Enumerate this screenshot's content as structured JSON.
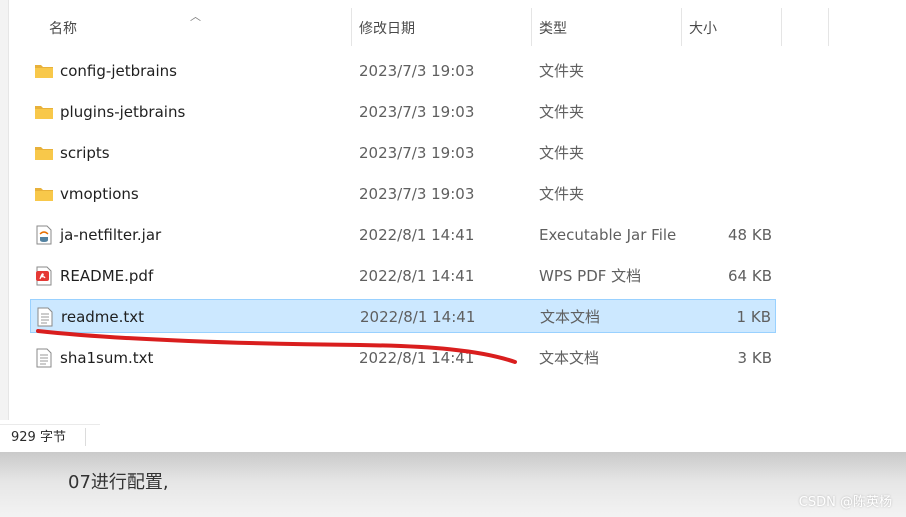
{
  "columns": {
    "name": "名称",
    "date": "修改日期",
    "type": "类型",
    "size": "大小"
  },
  "files": [
    {
      "name": "config-jetbrains",
      "date": "2023/7/3 19:03",
      "type": "文件夹",
      "size": "",
      "icon": "folder-icon"
    },
    {
      "name": "plugins-jetbrains",
      "date": "2023/7/3 19:03",
      "type": "文件夹",
      "size": "",
      "icon": "folder-icon"
    },
    {
      "name": "scripts",
      "date": "2023/7/3 19:03",
      "type": "文件夹",
      "size": "",
      "icon": "folder-icon"
    },
    {
      "name": "vmoptions",
      "date": "2023/7/3 19:03",
      "type": "文件夹",
      "size": "",
      "icon": "folder-icon"
    },
    {
      "name": "ja-netfilter.jar",
      "date": "2022/8/1 14:41",
      "type": "Executable Jar File",
      "size": "48 KB",
      "icon": "jar-file-icon"
    },
    {
      "name": "README.pdf",
      "date": "2022/8/1 14:41",
      "type": "WPS PDF 文档",
      "size": "64 KB",
      "icon": "pdf-file-icon"
    },
    {
      "name": "readme.txt",
      "date": "2022/8/1 14:41",
      "type": "文本文档",
      "size": "1 KB",
      "icon": "text-file-icon",
      "selected": true
    },
    {
      "name": "sha1sum.txt",
      "date": "2022/8/1 14:41",
      "type": "文本文档",
      "size": "3 KB",
      "icon": "text-file-icon"
    }
  ],
  "status_bar": {
    "selection_size": "929 字节"
  },
  "below": {
    "text": "07进行配置,",
    "watermark": "CSDN @陈英杨"
  },
  "colors": {
    "selection_bg": "#cce8ff",
    "selection_border": "#99d1ff",
    "folder": "#f8c84a",
    "annotation_stroke": "#d91e1e"
  }
}
